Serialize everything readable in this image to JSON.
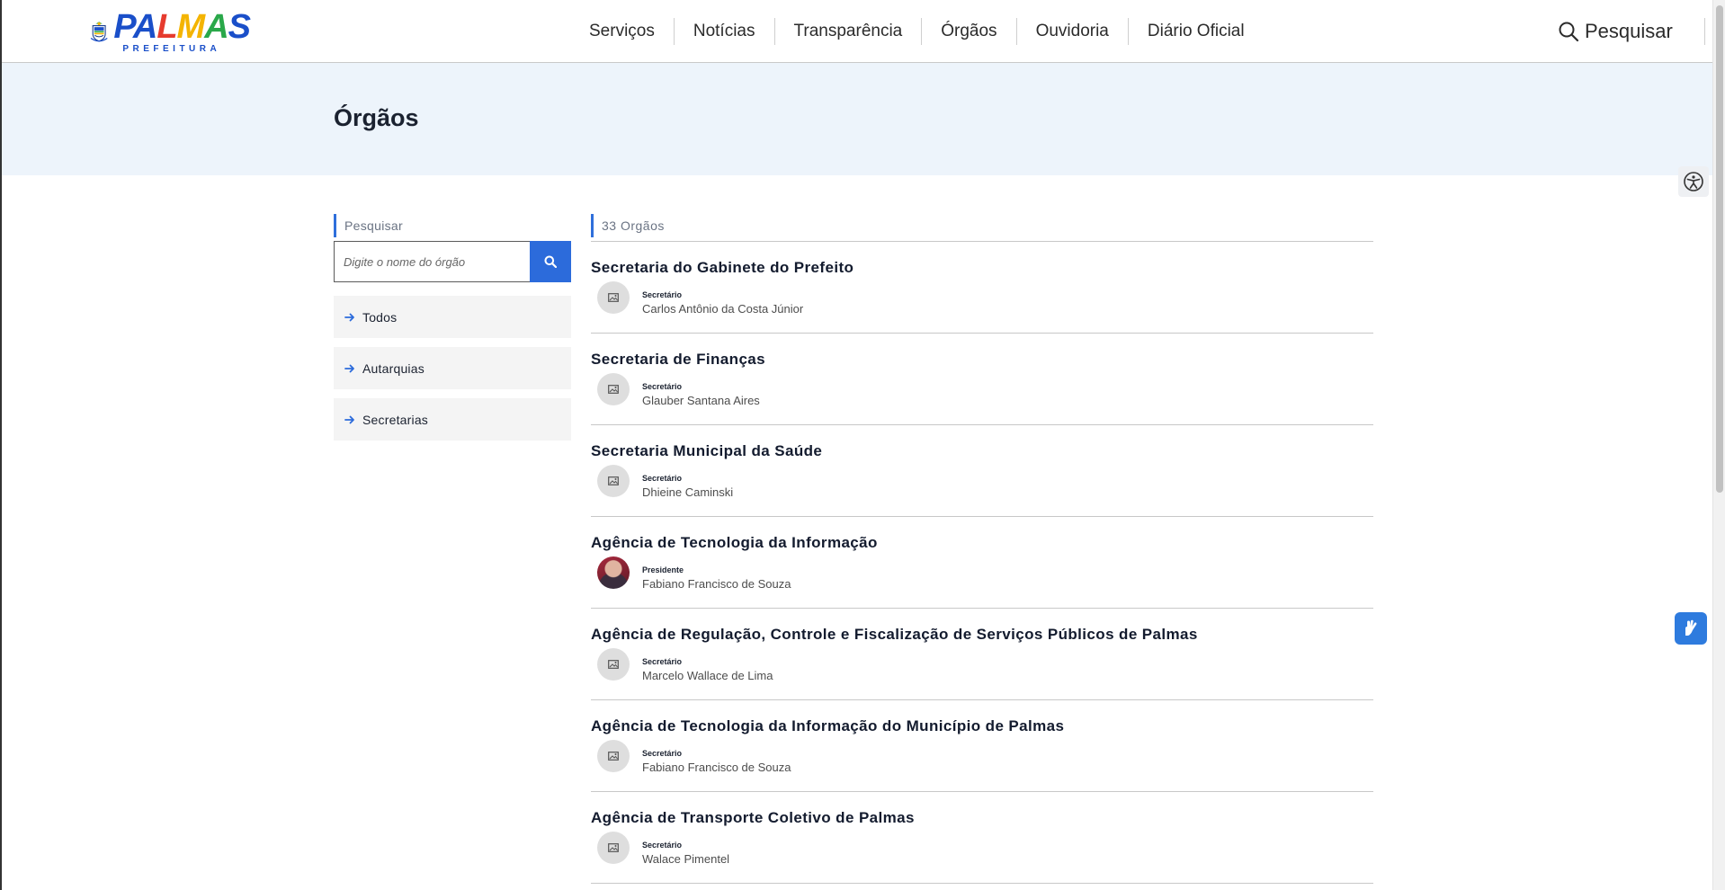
{
  "header": {
    "logo": {
      "word": [
        "P",
        "A",
        "L",
        "M",
        "A",
        "S"
      ],
      "sub": "PREFEITURA"
    },
    "nav": [
      {
        "label": "Serviços"
      },
      {
        "label": "Notícias"
      },
      {
        "label": "Transparência"
      },
      {
        "label": "Órgãos"
      },
      {
        "label": "Ouvidoria"
      },
      {
        "label": "Diário Oficial"
      }
    ],
    "search_label": "Pesquisar"
  },
  "banner": {
    "title": "Órgãos"
  },
  "sidebar": {
    "search_label": "Pesquisar",
    "search_placeholder": "Digite o nome do órgão",
    "filters": [
      {
        "label": "Todos"
      },
      {
        "label": "Autarquias"
      },
      {
        "label": "Secretarias"
      }
    ]
  },
  "list": {
    "count_label": "33 Orgãos",
    "items": [
      {
        "name": "Secretaria do Gabinete do Prefeito",
        "role": "Secretário",
        "person": "Carlos Antônio da Costa Júnior",
        "photo": false
      },
      {
        "name": "Secretaria de Finanças",
        "role": "Secretário",
        "person": "Glauber Santana Aires",
        "photo": false
      },
      {
        "name": "Secretaria Municipal da Saúde",
        "role": "Secretário",
        "person": "Dhieine Caminski",
        "photo": false
      },
      {
        "name": "Agência de Tecnologia da Informação",
        "role": "Presidente",
        "person": "Fabiano Francisco de Souza",
        "photo": true
      },
      {
        "name": "Agência de Regulação, Controle e Fiscalização de Serviços Públicos de Palmas",
        "role": "Secretário",
        "person": "Marcelo Wallace de Lima",
        "photo": false
      },
      {
        "name": "Agência de Tecnologia da Informação do Município de Palmas",
        "role": "Secretário",
        "person": "Fabiano Francisco de Souza",
        "photo": false
      },
      {
        "name": "Agência de Transporte Coletivo de Palmas",
        "role": "Secretário",
        "person": "Walace Pimentel",
        "photo": false
      }
    ]
  },
  "colors": {
    "accent": "#2c6bdb",
    "banner_bg": "#edf4fb",
    "libras_button": "#2e7bde"
  },
  "icons": {
    "search": "search-icon",
    "arrow": "arrow-right-icon",
    "image_placeholder": "image-placeholder-icon",
    "accessibility": "accessibility-icon",
    "libras": "sign-language-icon"
  }
}
